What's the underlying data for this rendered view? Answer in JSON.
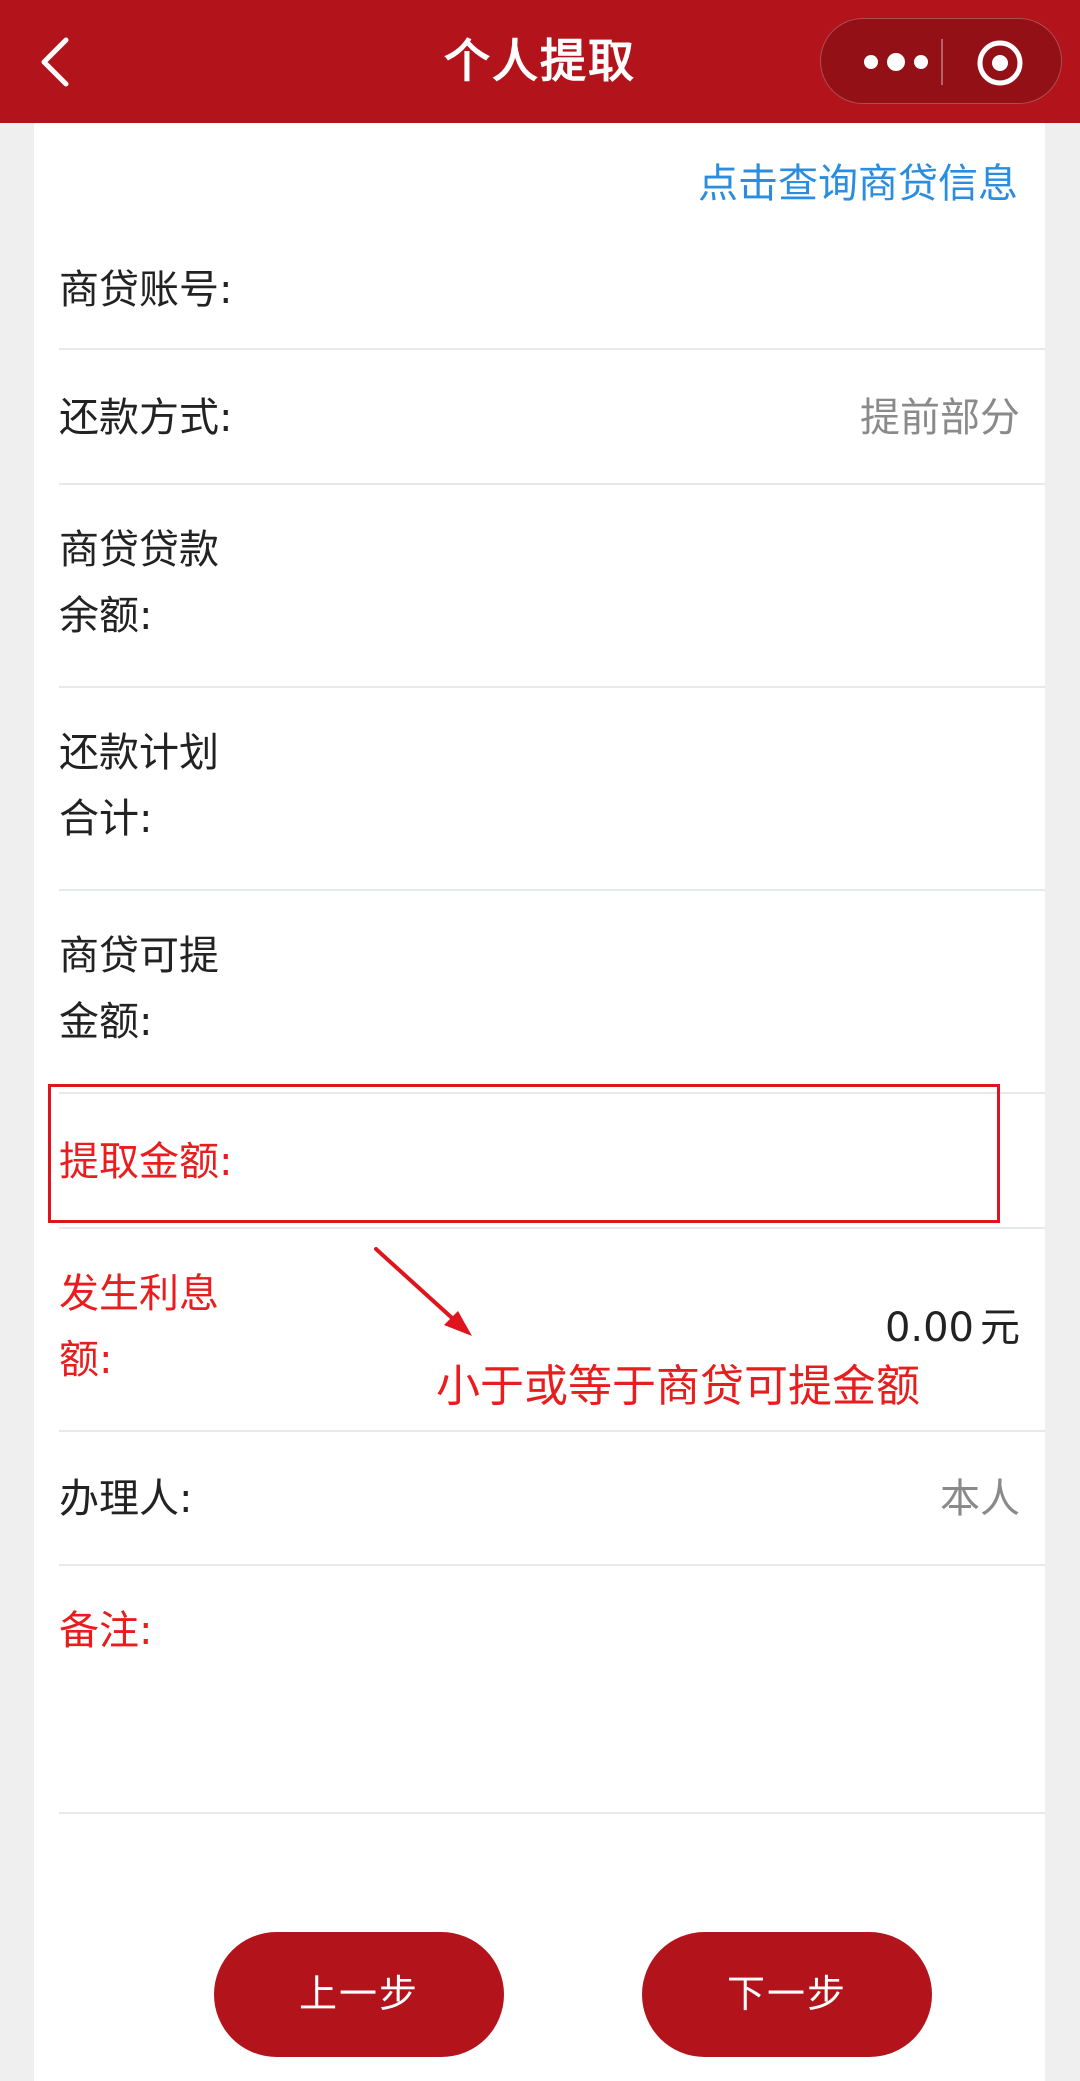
{
  "header": {
    "title": "个人提取",
    "back_icon": "chevron-left-icon",
    "more_icon": "more-dots-icon",
    "close_icon": "target-circle-icon"
  },
  "form": {
    "query_link": "点击查询商贷信息",
    "rows": [
      {
        "label": "商贷账号:",
        "value": ""
      },
      {
        "label": "还款方式:",
        "value": "提前部分"
      },
      {
        "label_lines": [
          "商贷贷款",
          "余额:"
        ],
        "value": ""
      },
      {
        "label_lines": [
          "还款计划",
          "合计:"
        ],
        "value": ""
      },
      {
        "label_lines": [
          "商贷可提",
          "金额:"
        ],
        "value": ""
      },
      {
        "label": "提取金额:",
        "value": ""
      },
      {
        "label_lines": [
          "发生利息",
          "额:"
        ],
        "value": "0.00",
        "unit": "元"
      },
      {
        "label": "办理人:",
        "value": "本人"
      },
      {
        "label": "备注:",
        "value": ""
      }
    ]
  },
  "annotation": {
    "text": "小于或等于商贷可提金额"
  },
  "buttons": {
    "prev": "上一步",
    "next": "下一步"
  },
  "colors": {
    "brand_red": "#b3141b",
    "label_red": "#e91d1d",
    "link_blue": "#2a8de0"
  }
}
